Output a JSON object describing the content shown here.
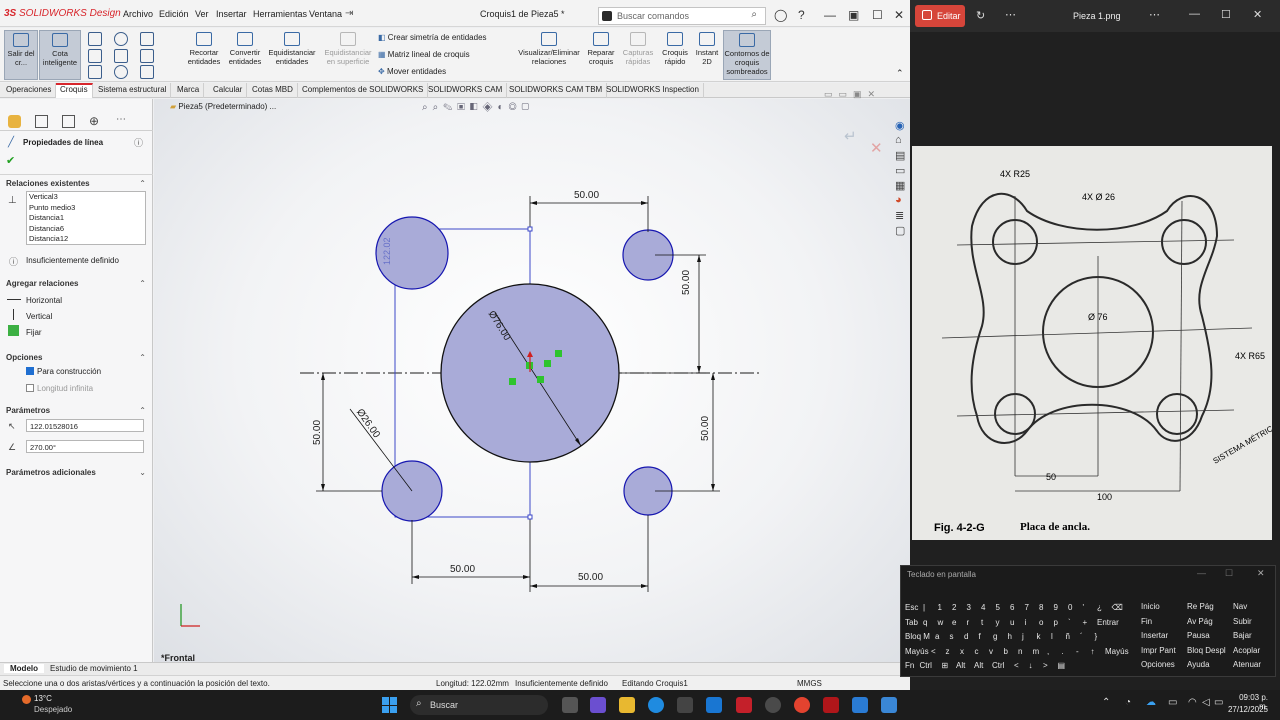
{
  "sw": {
    "logo": "SOLIDWORKS",
    "logo_suffix": "Design",
    "menus": [
      "Archivo",
      "Edición",
      "Ver",
      "Insertar",
      "Herramientas",
      "Ventana"
    ],
    "doc_title": "Croquis1 de Pieza5 *",
    "search_placeholder": "Buscar comandos",
    "cmd": {
      "exit_sketch": "Salir del cr...",
      "smart_dim": "Cota inteligente",
      "trim": "Recortar entidades",
      "convert": "Convertir entidades",
      "offset": "Equidistanciar entidades",
      "offset_surface": "Equidistanciar en superficie",
      "mirror": "Crear simetría de entidades",
      "linear_pattern": "Matriz lineal de croquis",
      "move": "Mover entidades",
      "relations": "Visualizar/Eliminar relaciones",
      "repair": "Reparar croquis",
      "rapid": "Capturas rápidas",
      "quick_sketch": "Croquis rápido",
      "instant2d": "Instant 2D",
      "shaded": "Contornos de croquis sombreados"
    },
    "tabs": [
      "Operaciones",
      "Croquis",
      "Sistema estructural",
      "Marca",
      "Calcular",
      "Cotas MBD",
      "Complementos de SOLIDWORKS",
      "SOLIDWORKS CAM",
      "SOLIDWORKS CAM TBM",
      "SOLIDWORKS Inspection"
    ],
    "breadcrumb": "Pieza5 (Predeterminado) ...",
    "panel": {
      "title": "Propiedades de línea",
      "existing_relations": "Relaciones existentes",
      "relations": [
        "Vertical3",
        "Punto medio3",
        "Distancia1",
        "Distancia6",
        "Distancia12"
      ],
      "underdefined": "Insuficientemente definido",
      "add_relations": "Agregar relaciones",
      "rel_options": [
        "Horizontal",
        "Vertical",
        "Fijar"
      ],
      "options": "Opciones",
      "for_construction": "Para construcción",
      "infinite_length": "Longitud infinita",
      "parameters": "Parámetros",
      "length_value": "122.01528016",
      "angle_value": "270.00°",
      "additional": "Parámetros adicionales"
    },
    "dims": {
      "top50": "50.00",
      "right50a": "50.00",
      "right50b": "50.00",
      "left50": "50.00",
      "bottom50a": "50.00",
      "bottom50b": "50.00",
      "dia76": "Ø76.00",
      "dia26": "Ø26.00",
      "small": "122.02"
    },
    "view_label": "*Frontal",
    "bottom_tabs": [
      "Modelo",
      "Estudio de movimiento 1"
    ],
    "status": {
      "hint": "Seleccione una o dos aristas/vértices y a continuación la posición del texto.",
      "length": "Longitud: 122.02mm",
      "state": "Insuficientemente definido",
      "editing": "Editando Croquis1",
      "units": "MMGS"
    }
  },
  "viewer": {
    "edit": "Editar",
    "title": "Pieza 1.png",
    "drawing": {
      "r25": "4X R25",
      "d26": "4X Ø 26",
      "d76": "Ø 76",
      "r65": "4X R65",
      "d50": "50",
      "d100": "100",
      "stamp": "SISTEMA MÉTRICO",
      "fig": "Fig. 4-2-G",
      "caption": "Placa de ancla."
    }
  },
  "keyboard": {
    "title": "Teclado en pantalla",
    "rows": [
      [
        "Esc",
        "|",
        "1",
        "2",
        "3",
        "4",
        "5",
        "6",
        "7",
        "8",
        "9",
        "0",
        "'",
        "¿",
        "⌫"
      ],
      [
        "Tab",
        "q",
        "w",
        "e",
        "r",
        "t",
        "y",
        "u",
        "i",
        "o",
        "p",
        "`",
        "+",
        "Entrar"
      ],
      [
        "Bloq M",
        "a",
        "s",
        "d",
        "f",
        "g",
        "h",
        "j",
        "k",
        "l",
        "ñ",
        "´",
        "}"
      ],
      [
        "Mayús",
        "<",
        "z",
        "x",
        "c",
        "v",
        "b",
        "n",
        "m",
        ",",
        ".",
        "-",
        "↑",
        "Mayús"
      ],
      [
        "Fn",
        "Ctrl",
        "⊞",
        "Alt",
        "Alt",
        "Ctrl",
        "<",
        "↓",
        ">",
        "▤"
      ]
    ],
    "nav": [
      [
        "Inicio",
        "Re Pág",
        "Nav"
      ],
      [
        "Fin",
        "Av Pág",
        "Subir"
      ],
      [
        "Insertar",
        "Pausa",
        "Bajar"
      ],
      [
        "Impr Pant",
        "Bloq Despl",
        "Acoplar"
      ],
      [
        "Opciones",
        "Ayuda",
        "Atenuar"
      ]
    ]
  },
  "taskbar": {
    "temp": "13°C",
    "weather": "Despejado",
    "search": "Buscar",
    "time": "09:03 p. m.",
    "date": "27/12/2025"
  }
}
